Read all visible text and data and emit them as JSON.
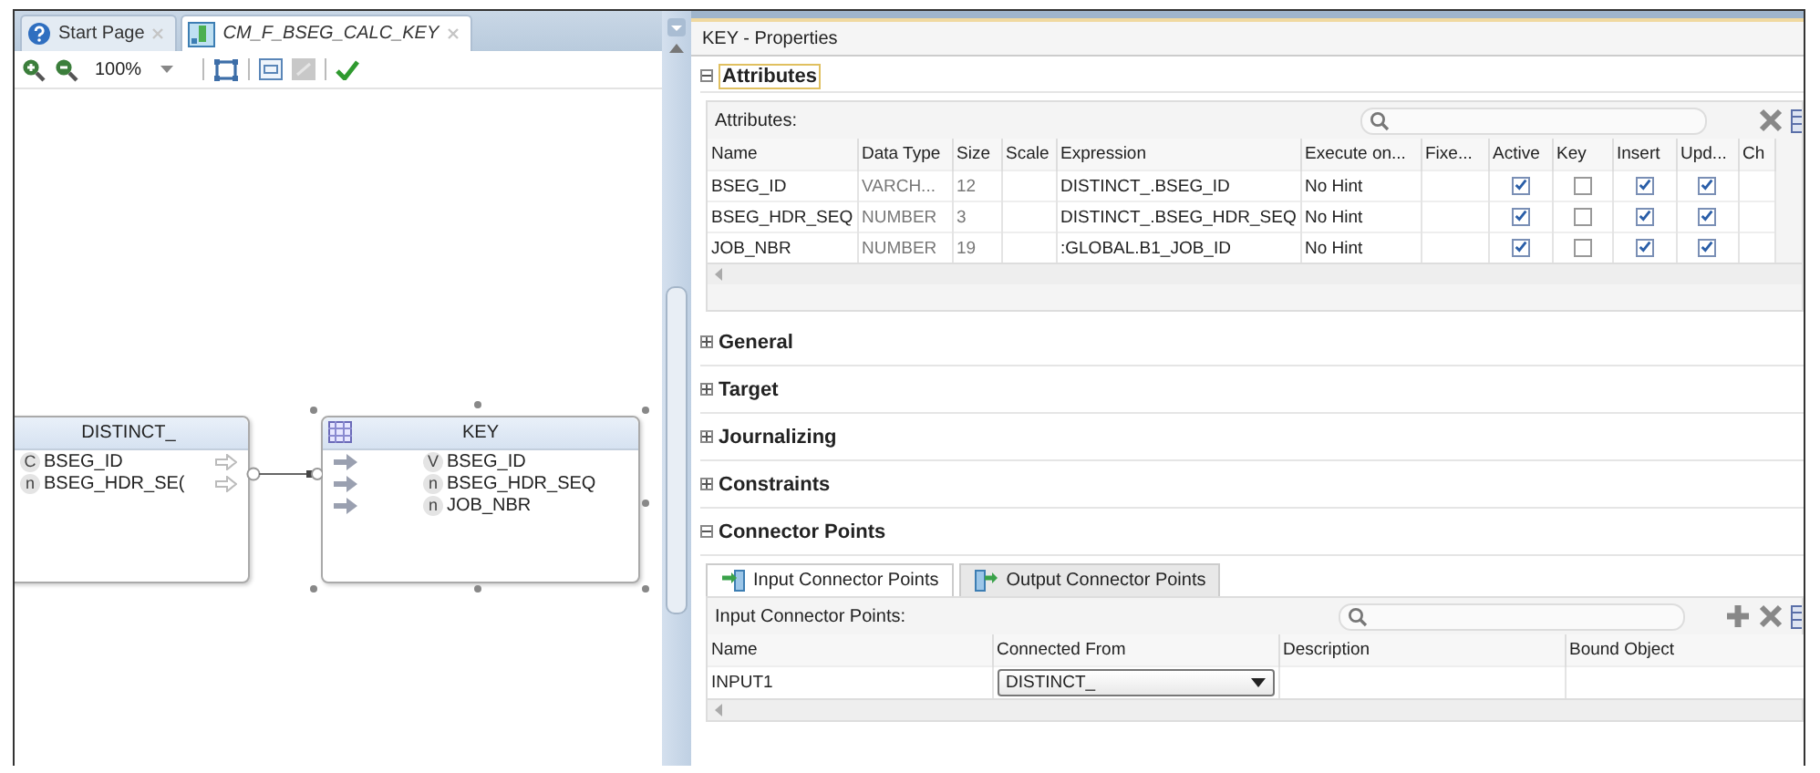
{
  "editor_tabs": [
    {
      "label": "Start Page",
      "kind": "help",
      "selected": false
    },
    {
      "label": "CM_F_BSEG_CALC_KEY",
      "kind": "diagram",
      "selected": true
    }
  ],
  "toolbar": {
    "zoom": "100%"
  },
  "diagram": {
    "nodes": [
      {
        "title": "DISTINCT_",
        "kind": "source",
        "attributes": [
          {
            "badge": "C",
            "name": "BSEG_ID"
          },
          {
            "badge": "n",
            "name": "BSEG_HDR_SE("
          }
        ]
      },
      {
        "title": "KEY",
        "kind": "target",
        "attributes": [
          {
            "badge": "V",
            "name": "BSEG_ID"
          },
          {
            "badge": "n",
            "name": "BSEG_HDR_SEQ"
          },
          {
            "badge": "n",
            "name": "JOB_NBR"
          }
        ]
      }
    ]
  },
  "properties": {
    "title": "KEY - Properties",
    "sections": [
      {
        "title": "Attributes",
        "kind": "attributes",
        "expanded": true
      },
      {
        "title": "General",
        "expanded": false
      },
      {
        "title": "Target",
        "expanded": false
      },
      {
        "title": "Journalizing",
        "expanded": false
      },
      {
        "title": "Constraints",
        "expanded": false
      },
      {
        "title": "Connector Points",
        "kind": "connectors",
        "expanded": true
      }
    ],
    "attributes": {
      "label": "Attributes:",
      "columns": [
        "Name",
        "Data Type",
        "Size",
        "Scale",
        "Expression",
        "Execute on...",
        "Fixe...",
        "Active",
        "Key",
        "Insert",
        "Upd...",
        "Ch"
      ],
      "rows": [
        {
          "name": "BSEG_ID",
          "data_type": "VARCH...",
          "size": "12",
          "expression": "DISTINCT_.BSEG_ID",
          "execute_on": "No Hint",
          "active": true,
          "key": false,
          "insert": true,
          "update": true
        },
        {
          "name": "BSEG_HDR_SEQ",
          "data_type": "NUMBER",
          "size": "3",
          "expression": "DISTINCT_.BSEG_HDR_SEQ",
          "execute_on": "No Hint",
          "active": true,
          "key": false,
          "insert": true,
          "update": true
        },
        {
          "name": "JOB_NBR",
          "data_type": "NUMBER",
          "size": "19",
          "expression": ":GLOBAL.B1_JOB_ID",
          "execute_on": "No Hint",
          "active": true,
          "key": false,
          "insert": true,
          "update": true
        }
      ]
    },
    "connectors": {
      "tabs": [
        {
          "label": "Input Connector Points",
          "kind": "input",
          "selected": true
        },
        {
          "label": "Output Connector Points",
          "kind": "output",
          "selected": false
        }
      ],
      "label": "Input Connector Points:",
      "columns": [
        "Name",
        "Connected From",
        "Description",
        "Bound Object"
      ],
      "rows": [
        {
          "name": "INPUT1",
          "connected_from": "DISTINCT_"
        }
      ]
    }
  }
}
